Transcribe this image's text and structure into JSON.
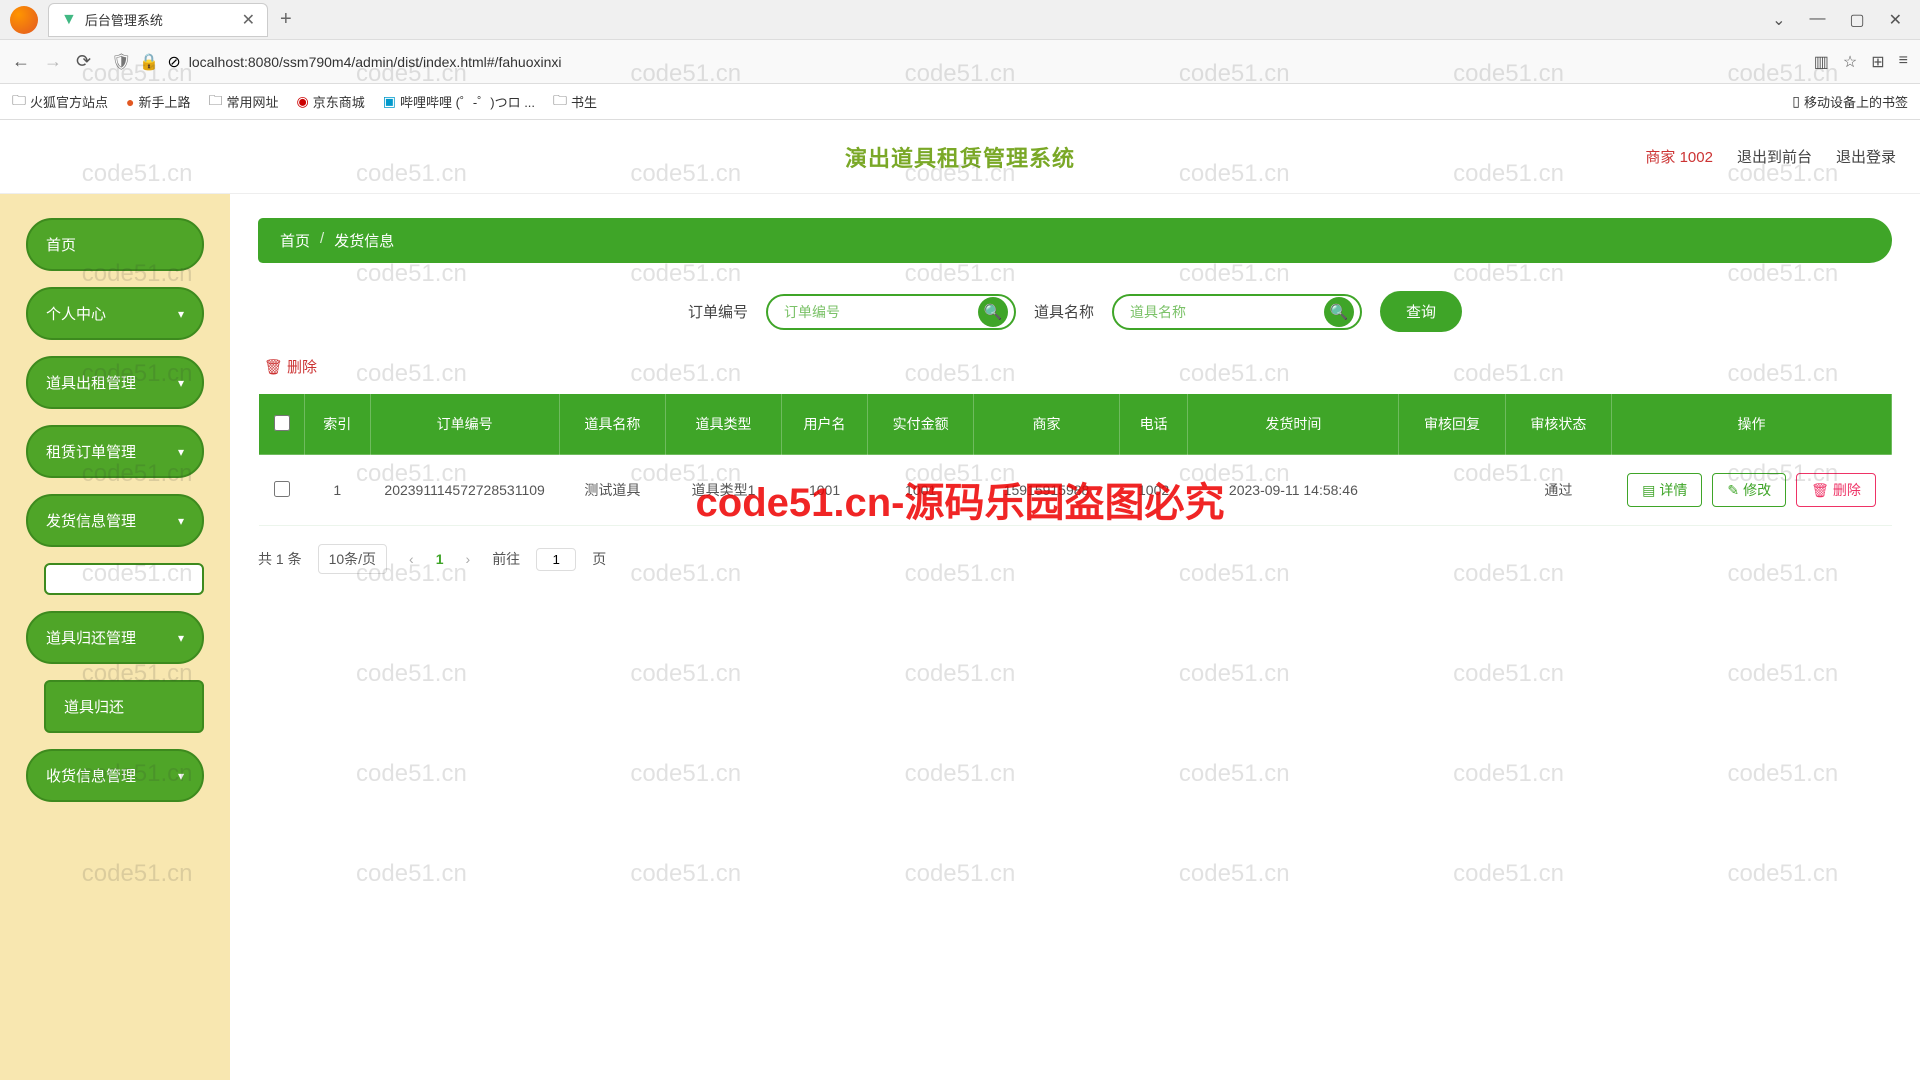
{
  "browser": {
    "tab_title": "后台管理系统",
    "url": "localhost:8080/ssm790m4/admin/dist/index.html#/fahuoxinxi"
  },
  "bookmarks": [
    "火狐官方站点",
    "新手上路",
    "常用网址",
    "京东商城",
    "哔哩哔哩 (゜-゜)つロ ...",
    "书生"
  ],
  "mobile_bookmarks": "移动设备上的书签",
  "header": {
    "title": "演出道具租赁管理系统",
    "merchant": "商家 1002",
    "exit_front": "退出到前台",
    "logout": "退出登录"
  },
  "sidebar": {
    "items": [
      {
        "label": "首页",
        "expandable": false
      },
      {
        "label": "个人中心",
        "expandable": true
      },
      {
        "label": "道具出租管理",
        "expandable": true
      },
      {
        "label": "租赁订单管理",
        "expandable": true
      },
      {
        "label": "发货信息管理",
        "expandable": true
      },
      {
        "label": "道具归还管理",
        "expandable": true
      },
      {
        "label": "收货信息管理",
        "expandable": true
      }
    ],
    "sub_white": "",
    "sub_return": "道具归还"
  },
  "breadcrumb": {
    "home": "首页",
    "current": "发货信息"
  },
  "search": {
    "order_label": "订单编号",
    "order_placeholder": "订单编号",
    "prop_label": "道具名称",
    "prop_placeholder": "道具名称",
    "query": "查询"
  },
  "toolbar": {
    "delete": "删除"
  },
  "table": {
    "headers": [
      "索引",
      "订单编号",
      "道具名称",
      "道具类型",
      "用户名",
      "实付金额",
      "商家",
      "电话",
      "发货时间",
      "审核回复",
      "审核状态",
      "操作"
    ],
    "rows": [
      {
        "idx": "1",
        "order_no": "202391114572728531109",
        "prop_name": "测试道具",
        "prop_type": "道具类型1",
        "user": "1001",
        "amount": "1001",
        "merchant": "15915915988",
        "phone": "1002",
        "ship_time": "2023-09-11 14:58:46",
        "audit_reply": "",
        "audit_status": "通过"
      }
    ],
    "actions": {
      "detail": "详情",
      "edit": "修改",
      "delete": "删除"
    }
  },
  "pagination": {
    "total": "共 1 条",
    "per_page": "10条/页",
    "current": "1",
    "goto_label": "前往",
    "goto_value": "1",
    "page_suffix": "页"
  },
  "watermark": "code51.cn",
  "big_watermark": "code51.cn-源码乐园盗图必究"
}
